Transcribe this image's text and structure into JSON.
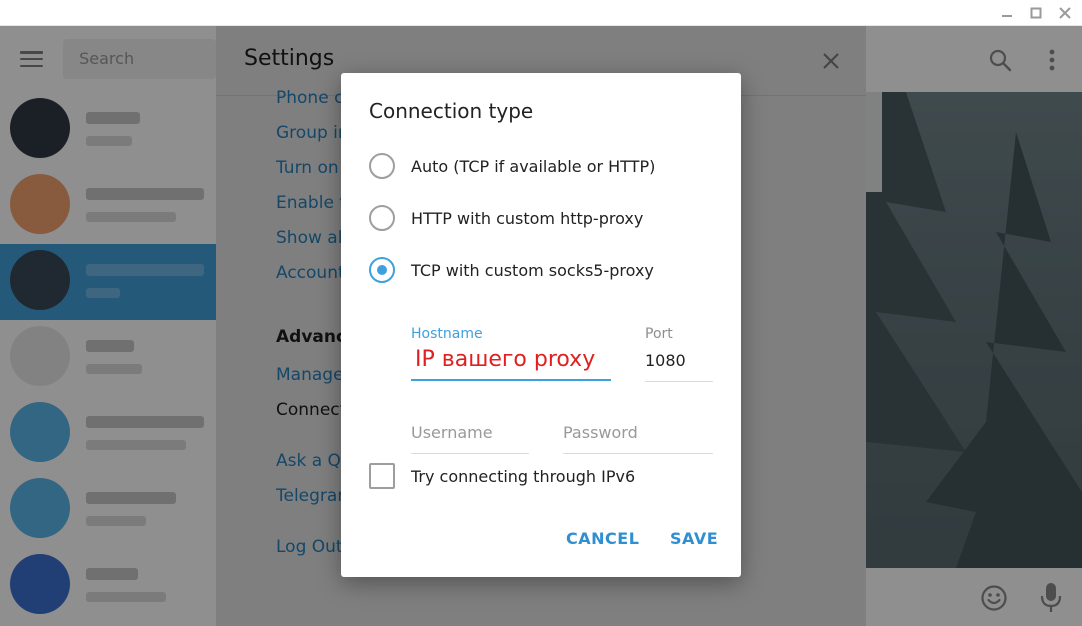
{
  "search": {
    "placeholder": "Search"
  },
  "settings": {
    "title": "Settings",
    "items": [
      {
        "label": "Phone ca"
      },
      {
        "label": "Group in"
      },
      {
        "label": "Turn on"
      },
      {
        "label": "Enable tw"
      },
      {
        "label": "Show all"
      },
      {
        "label": "Account"
      }
    ],
    "advanced_section": "Advance",
    "advanced_items": [
      {
        "label": "Manage"
      },
      {
        "label": "Connect"
      },
      {
        "label": "Ask a Qu"
      },
      {
        "label": "Telegram"
      },
      {
        "label": "Log Out"
      }
    ]
  },
  "dialog": {
    "title": "Connection type",
    "options": [
      {
        "label": "Auto (TCP if available or HTTP)",
        "selected": false
      },
      {
        "label": "HTTP with custom http-proxy",
        "selected": false
      },
      {
        "label": "TCP with custom socks5-proxy",
        "selected": true
      }
    ],
    "hostname": {
      "label": "Hostname",
      "value": "IP вашего proxy"
    },
    "port": {
      "label": "Port",
      "value": "1080"
    },
    "username": {
      "placeholder": "Username"
    },
    "password": {
      "placeholder": "Password"
    },
    "ipv6": {
      "label": "Try connecting through IPv6",
      "checked": false
    },
    "cancel_label": "CANCEL",
    "save_label": "SAVE"
  },
  "colors": {
    "accent": "#3ea0e0",
    "link": "#2b8fd1",
    "annotation": "#e02020",
    "selected_chat": "#419fd9"
  }
}
